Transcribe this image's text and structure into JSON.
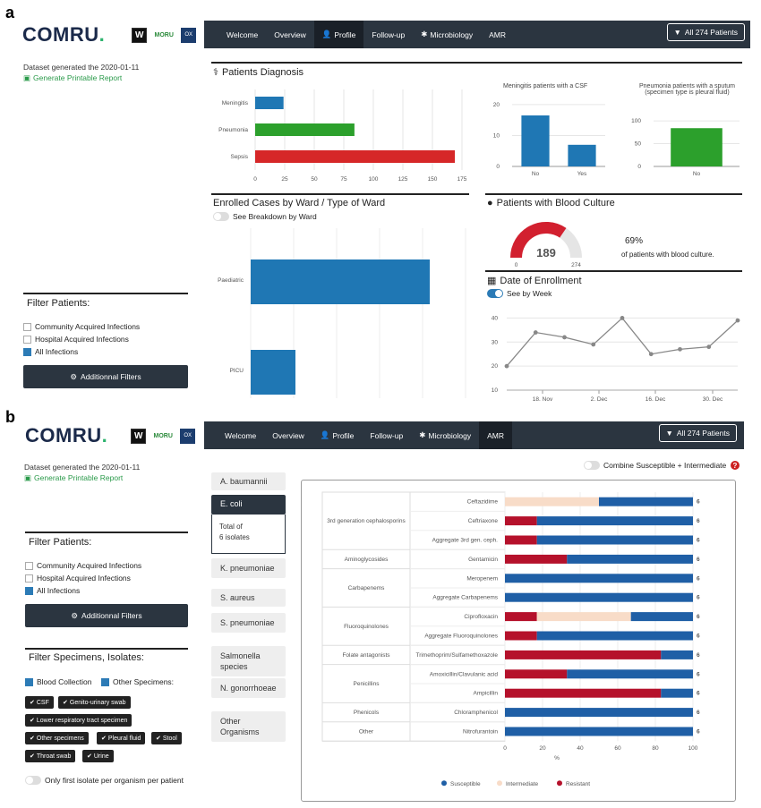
{
  "panel_a": {
    "label": "a",
    "brand": {
      "name": "COMRU",
      "dot": ".",
      "badge1": "W",
      "badge2": "MORU",
      "badge3": "OX"
    },
    "dataset_text": "Dataset generated the 2020-01-11",
    "report_link": "Generate Printable Report",
    "nav": {
      "items": [
        "Welcome",
        "Overview",
        "Profile",
        "Follow-up",
        "Microbiology",
        "AMR"
      ],
      "active": "Profile",
      "filter_button": "All 274 Patients"
    },
    "diagnosis": {
      "title": "Patients Diagnosis",
      "chart_data": {
        "type": "bar",
        "orientation": "horizontal",
        "categories": [
          "Meningitis",
          "Pneumonia",
          "Sepsis"
        ],
        "values": [
          24,
          84,
          169
        ],
        "colors": [
          "#1f77b4",
          "#2ca02c",
          "#d62728"
        ],
        "xticks": [
          "0",
          "25",
          "50",
          "75",
          "100",
          "125",
          "150",
          "175"
        ],
        "xlim": [
          0,
          175
        ]
      }
    },
    "csf": {
      "title": "Meningitis patients with a CSF",
      "chart_data": {
        "type": "bar",
        "categories": [
          "No",
          "Yes"
        ],
        "values": [
          16.5,
          7
        ],
        "color": "#1f77b4",
        "yticks": [
          "0",
          "10",
          "20"
        ],
        "ylim": [
          0,
          22
        ]
      }
    },
    "sputum": {
      "title": "Pneumonia patients with a sputum (specimen type is pleural fluid)",
      "chart_data": {
        "type": "bar",
        "categories": [
          "No"
        ],
        "values": [
          84
        ],
        "color": "#2ca02c",
        "yticks": [
          "0",
          "50",
          "100"
        ],
        "ylim": [
          0,
          110
        ]
      }
    },
    "ward": {
      "title": "Enrolled Cases by Ward / Type of Ward",
      "toggle_label": "See Breakdown by Ward",
      "chart_data": {
        "type": "bar",
        "orientation": "horizontal",
        "categories": [
          "Paediatric",
          "PICU"
        ],
        "values": [
          100,
          25
        ],
        "color": "#1f77b4"
      }
    },
    "blood_culture": {
      "title": "Patients with Blood Culture",
      "value": "189",
      "min": "0",
      "max": "274",
      "fraction": 0.69,
      "percent_text": "69%",
      "caption": "of patients with blood culture."
    },
    "enrollment": {
      "title": "Date of Enrollment",
      "toggle_label": "See by Week",
      "chart_data": {
        "type": "line",
        "values": [
          20,
          34,
          32,
          29,
          40,
          25,
          27,
          28,
          39
        ],
        "yticks": [
          "10",
          "20",
          "30",
          "40"
        ],
        "xticks": [
          "18. Nov",
          "2. Dec",
          "16. Dec",
          "30. Dec"
        ],
        "ylim": [
          10,
          45
        ],
        "color": "#888888"
      }
    },
    "filter": {
      "title": "Filter Patients:",
      "options": [
        "Community Acquired Infections",
        "Hospital Acquired Infections",
        "All Infections"
      ],
      "button": "Additionnal Filters"
    }
  },
  "panel_b": {
    "label": "b",
    "brand": {
      "name": "COMRU",
      "dot": ".",
      "badge1": "W",
      "badge2": "MORU",
      "badge3": "OX"
    },
    "dataset_text": "Dataset generated the 2020-01-11",
    "report_link": "Generate Printable Report",
    "nav": {
      "items": [
        "Welcome",
        "Overview",
        "Profile",
        "Follow-up",
        "Microbiology",
        "AMR"
      ],
      "active": "AMR",
      "filter_button": "All 274 Patients"
    },
    "filter": {
      "title": "Filter Patients:",
      "options": [
        "Community Acquired Infections",
        "Hospital Acquired Infections",
        "All Infections"
      ],
      "button": "Additionnal Filters"
    },
    "specimens": {
      "title": "Filter Specimens, Isolates:",
      "blood": "Blood Collection",
      "other": "Other Specimens:",
      "tags": [
        "CSF",
        "Genito-urinary swab",
        "Lower respiratory tract specimen",
        "Other specimens",
        "Pleural fluid",
        "Stool",
        "Throat swab",
        "Urine"
      ],
      "first_isolate": "Only first isolate per organism per patient"
    },
    "organisms": {
      "items": [
        "A. baumannii",
        "E. coli",
        "K. pneumoniae",
        "S. aureus",
        "S. pneumoniae",
        "Salmonella species",
        "N. gonorrhoeae",
        "Other Organisms"
      ],
      "active": "E. coli",
      "detail_line1": "Total of",
      "detail_line2": "6 isolates"
    },
    "combine_label": "Combine Susceptible + Intermediate",
    "help": "?",
    "amr": {
      "chart_data": {
        "type": "bar",
        "orientation": "horizontal",
        "stacked": true,
        "xlabel": "%",
        "xticks": [
          "0",
          "20",
          "40",
          "60",
          "80",
          "100"
        ],
        "xlim": [
          0,
          100
        ],
        "groups": [
          {
            "name": "3rd generation cephalosporins",
            "rows": [
              "Ceftazidime",
              "Ceftriaxone",
              "Aggregate 3rd gen. ceph."
            ]
          },
          {
            "name": "Aminoglycosides",
            "rows": [
              "Gentamicin"
            ]
          },
          {
            "name": "Carbapenems",
            "rows": [
              "Meropenem",
              "Aggregate Carbapenems"
            ]
          },
          {
            "name": "Fluoroquinolones",
            "rows": [
              "Ciprofloxacin",
              "Aggregate Fluoroquinolones"
            ]
          },
          {
            "name": "Folate antagonists",
            "rows": [
              "Trimethoprim/Sulfamethoxazole"
            ]
          },
          {
            "name": "Penicillins",
            "rows": [
              "Amoxicillin/Clavulanic acid",
              "Ampicillin"
            ]
          },
          {
            "name": "Phenicols",
            "rows": [
              "Chloramphenicol"
            ]
          },
          {
            "name": "Other",
            "rows": [
              "Nitrofurantoin"
            ]
          }
        ],
        "rows": [
          {
            "antibiotic": "Ceftazidime",
            "resistant": 0,
            "intermediate": 50,
            "susceptible": 50,
            "n": "6"
          },
          {
            "antibiotic": "Ceftriaxone",
            "resistant": 17,
            "intermediate": 0,
            "susceptible": 83,
            "n": "6"
          },
          {
            "antibiotic": "Aggregate 3rd gen. ceph.",
            "resistant": 17,
            "intermediate": 0,
            "susceptible": 83,
            "n": "6"
          },
          {
            "antibiotic": "Gentamicin",
            "resistant": 33,
            "intermediate": 0,
            "susceptible": 67,
            "n": "6"
          },
          {
            "antibiotic": "Meropenem",
            "resistant": 0,
            "intermediate": 0,
            "susceptible": 100,
            "n": "6"
          },
          {
            "antibiotic": "Aggregate Carbapenems",
            "resistant": 0,
            "intermediate": 0,
            "susceptible": 100,
            "n": "6"
          },
          {
            "antibiotic": "Ciprofloxacin",
            "resistant": 17,
            "intermediate": 50,
            "susceptible": 33,
            "n": "6"
          },
          {
            "antibiotic": "Aggregate Fluoroquinolones",
            "resistant": 17,
            "intermediate": 0,
            "susceptible": 83,
            "n": "6"
          },
          {
            "antibiotic": "Trimethoprim/Sulfamethoxazole",
            "resistant": 83,
            "intermediate": 0,
            "susceptible": 17,
            "n": "6"
          },
          {
            "antibiotic": "Amoxicillin/Clavulanic acid",
            "resistant": 33,
            "intermediate": 0,
            "susceptible": 67,
            "n": "6"
          },
          {
            "antibiotic": "Ampicillin",
            "resistant": 83,
            "intermediate": 0,
            "susceptible": 17,
            "n": "6"
          },
          {
            "antibiotic": "Chloramphenicol",
            "resistant": 0,
            "intermediate": 0,
            "susceptible": 100,
            "n": "6"
          },
          {
            "antibiotic": "Nitrofurantoin",
            "resistant": 0,
            "intermediate": 0,
            "susceptible": 100,
            "n": "6"
          }
        ],
        "legend": [
          "Susceptible",
          "Intermediate",
          "Resistant"
        ],
        "colors": {
          "susceptible": "#1f5fa6",
          "intermediate": "#f8dcc8",
          "resistant": "#b5112b"
        }
      }
    }
  }
}
